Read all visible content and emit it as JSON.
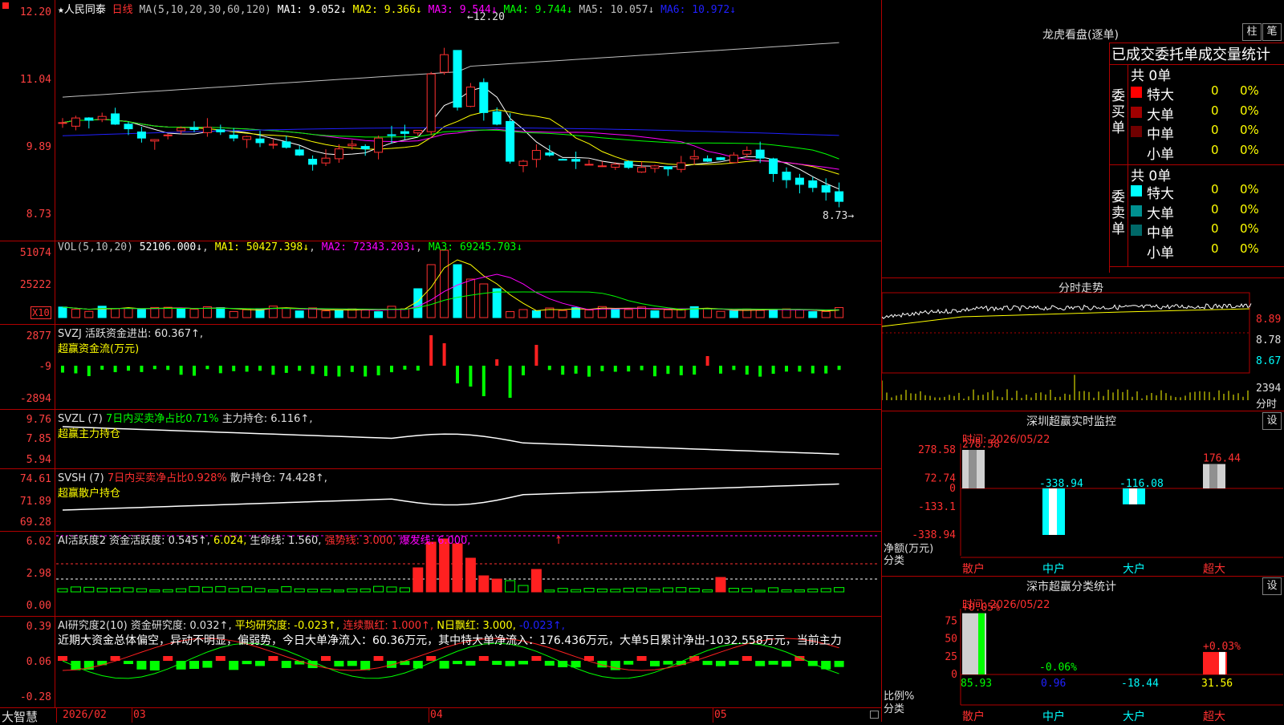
{
  "app": {
    "brand": "大智慧"
  },
  "main_chart": {
    "stock_name": "人民同泰",
    "period": "日线",
    "ma_params": "MA(5,10,20,30,60,120)",
    "ma_labels": [
      "MA1: 9.052↓",
      "MA2: 9.366↓",
      "MA3: 9.544↓",
      "MA4: 9.744↓",
      "MA5: 10.057↓",
      "MA6: 10.972↓"
    ],
    "ma_colors": [
      "#ffffff",
      "#ffff00",
      "#ff00ff",
      "#00ff00",
      "#c0c0c0",
      "#2020ff"
    ],
    "y_ticks": [
      "12.20",
      "11.04",
      "9.89",
      "8.73"
    ],
    "high_label": "12.20",
    "low_label": "8.73",
    "ylim": [
      8.6,
      12.3
    ]
  },
  "vol_pane": {
    "params": "VOL(5,10,20)",
    "vol_value": "52106.000↓",
    "ma_labels": [
      "MA1: 50427.398↓",
      "MA2: 72343.203↓",
      "MA3: 69245.703↓"
    ],
    "ma_colors": [
      "#ffff00",
      "#ff00ff",
      "#00ff00"
    ],
    "y_ticks": [
      "51074",
      "25222"
    ],
    "unit": "X10"
  },
  "svzj_pane": {
    "title": "SVZJ",
    "label": "活跃资金进出: 60.367↑,",
    "subtitle": "超赢资金流(万元)",
    "y_ticks": [
      "2877",
      "-9",
      "-2894"
    ]
  },
  "svzl_pane": {
    "title": "SVZL (7)",
    "label1": "7日内买卖净占比0.71%",
    "label2": "主力持仓: 6.116↑,",
    "subtitle": "超赢主力持仓",
    "y_ticks": [
      "9.76",
      "7.85",
      "5.94"
    ]
  },
  "svsh_pane": {
    "title": "SVSH (7)",
    "label1": "7日内买卖净占比0.928%",
    "label2": "散户持仓: 74.428↑,",
    "subtitle": "超赢散户持仓",
    "y_ticks": [
      "74.61",
      "71.89",
      "69.28"
    ]
  },
  "ai_active_pane": {
    "title": "AI活跃度2",
    "label1": "资金活跃度: 0.545↑,",
    "label2": "6.024,",
    "label3": "生命线: 1.560,",
    "label4": "强势线: 3.000,",
    "label5": "爆发线: 6.000,",
    "arrow": "↑",
    "y_ticks": [
      "6.02",
      "2.98",
      "0.00"
    ]
  },
  "ai_research_pane": {
    "title": "AI研究度2(10)",
    "label1": "资金研究度: 0.032↑,",
    "label2": "平均研究度: -0.023↑,",
    "label3": "连续飘红: 1.000↑,",
    "label4": "N日飘红: 3.000,",
    "label5": "-0.023↑,",
    "commentary": "近期大资金总体偏空，异动不明显，偏弱势，今日大单净流入：60.36万元，其中特大单净流入：176.436万元，大单5日累计净出-1032.558万元，当前主力",
    "y_ticks": [
      "0.39",
      "0.06",
      "-0.28"
    ]
  },
  "x_axis": {
    "labels": [
      "2026/02",
      "03",
      "04",
      "05"
    ]
  },
  "dragon_tiger": {
    "title": "龙虎看盘(逐单)",
    "buttons": [
      "柱",
      "笔"
    ],
    "stats_title": "已成交委托单成交量统计",
    "buy_side": {
      "side_label": "委买单",
      "total": "共 0单",
      "rows": [
        {
          "name": "特大",
          "count": "0",
          "pct": "0%",
          "color": "#ff0000"
        },
        {
          "name": "大单",
          "count": "0",
          "pct": "0%",
          "color": "#a00000"
        },
        {
          "name": "中单",
          "count": "0",
          "pct": "0%",
          "color": "#700000"
        },
        {
          "name": "小单",
          "count": "0",
          "pct": "0%",
          "color": "#000000"
        }
      ]
    },
    "sell_side": {
      "side_label": "委卖单",
      "total": "共 0单",
      "rows": [
        {
          "name": "特大",
          "count": "0",
          "pct": "0%",
          "color": "#00ffff"
        },
        {
          "name": "大单",
          "count": "0",
          "pct": "0%",
          "color": "#009090"
        },
        {
          "name": "中单",
          "count": "0",
          "pct": "0%",
          "color": "#006868"
        },
        {
          "name": "小单",
          "count": "0",
          "pct": "0%",
          "color": "#000000"
        }
      ]
    }
  },
  "intraday": {
    "title": "分时走势",
    "y_ticks": [
      "8.89",
      "8.78",
      "8.67"
    ],
    "vol_tick": "2394",
    "vol_label": "分时"
  },
  "sz_monitor": {
    "title": "深圳超赢实时监控",
    "settings_button": "设",
    "time_label": "时间: 2026/05/22",
    "y_ticks": [
      "278.58",
      "72.74",
      "0",
      "-133.1",
      "-338.94"
    ],
    "ylabel1": "净额(万元)",
    "ylabel2": "分类",
    "chart_data": {
      "type": "bar",
      "categories": [
        "散户",
        "中户",
        "大户",
        "超大"
      ],
      "values": [
        278.58,
        -338.94,
        -116.08,
        176.44
      ],
      "ylim": [
        -338.94,
        278.58
      ]
    }
  },
  "sz_classify": {
    "title": "深市超赢分类统计",
    "settings_button": "设",
    "time_label": "时间: 2026/05/22",
    "y_ticks": [
      "75",
      "50",
      "25",
      "0"
    ],
    "ylabel1": "比例%",
    "ylabel2": "分类",
    "chart_data": {
      "type": "bar",
      "categories": [
        "散户",
        "中户",
        "大户",
        "超大"
      ],
      "values": [
        85.93,
        0.96,
        -18.44,
        31.56
      ],
      "top_labels": [
        "+0.05%",
        "-0.06%",
        "",
        "+0.03%"
      ],
      "bottom_labels": [
        "85.93",
        "0.96",
        "-18.44",
        "31.56"
      ],
      "ylim": [
        0,
        90
      ]
    }
  }
}
